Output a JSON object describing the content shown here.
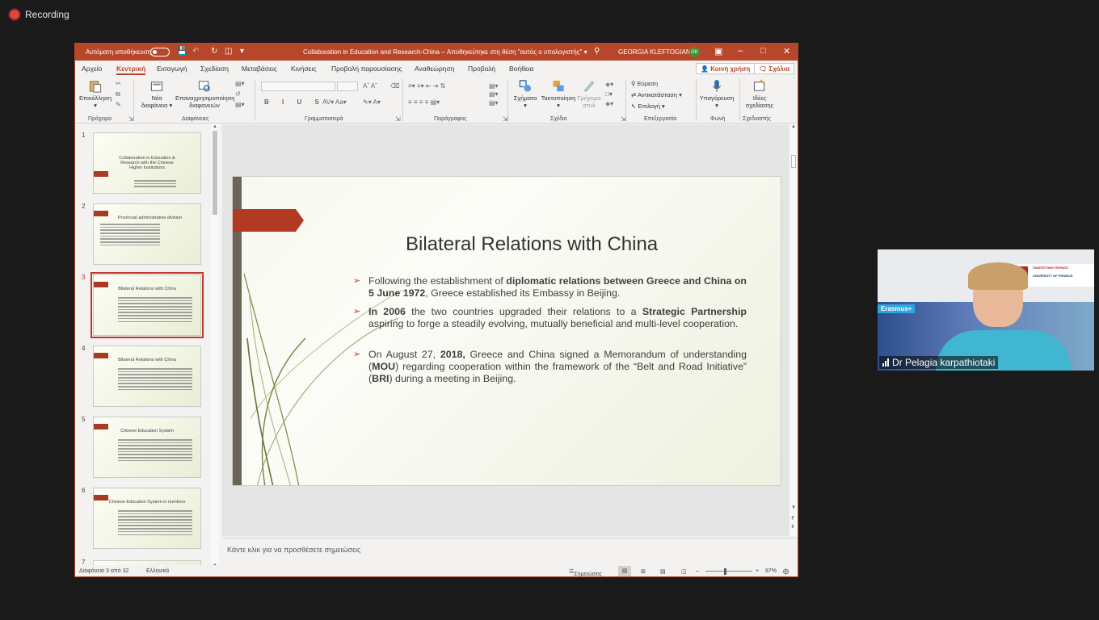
{
  "recording": {
    "label": "Recording"
  },
  "titlebar": {
    "autosave": "Αυτόματη αποθήκευση",
    "document": "Collaboration in Education and Research-China",
    "saved": "Αποθηκεύτηκε στη θέση \"αυτός ο υπολογιστής\"",
    "user": "GEORGIA KLEFTOGIANNI",
    "avatar": "GK"
  },
  "tabs": [
    "Αρχείο",
    "Κεντρική",
    "Εισαγωγή",
    "Σχεδίαση",
    "Μεταβάσεις",
    "Κινήσεις",
    "Προβολή παρουσίασης",
    "Αναθεώρηση",
    "Προβολή",
    "Βοήθεια"
  ],
  "active_tab": "Κεντρική",
  "share": "Κοινή χρήση",
  "comments": "Σχόλια",
  "ribbon": {
    "paste": "Επικόλληση",
    "new_slide": "Νέα διαφάνεια",
    "reuse": "Επαναχρησιμοποίηση διαφανειών",
    "shapes": "Σχήματα",
    "arrange": "Τακτοποίηση",
    "quick_styles": "Γρήγορα στυλ",
    "find": "Εύρεση",
    "replace": "Αντικατάσταση",
    "select": "Επιλογή",
    "dictate": "Υπαγόρευση",
    "ideas": "Ιδέες σχεδίασης",
    "groups": [
      "Πρόχειρο",
      "Διαφάνειες",
      "Γραμματοσειρά",
      "Παράγραφος",
      "Σχέδιο",
      "Επεξεργασία",
      "Φωνή",
      "Σχεδιαστής"
    ]
  },
  "thumbnails": [
    {
      "num": "1",
      "title": "Collaboration in Education & Research with the Chinese Higher Institutions"
    },
    {
      "num": "2",
      "title": "Provincial administrative division"
    },
    {
      "num": "3",
      "title": "Bilateral Relations with China"
    },
    {
      "num": "4",
      "title": "Bilateral Relations with China"
    },
    {
      "num": "5",
      "title": "Chinese Education System"
    },
    {
      "num": "6",
      "title": "Chinese Education System in numbers"
    },
    {
      "num": "7",
      "title": ""
    }
  ],
  "slide": {
    "title": "Bilateral Relations with China",
    "bullets": [
      [
        "Following the establishment of ",
        "diplomatic relations between Greece and China on 5 June 1972",
        ", Greece established its Embassy in Beijing."
      ],
      [
        "",
        "In 2006",
        " the two countries upgraded their relations to a ",
        "Strategic Partnership",
        " aspiring to forge a steadily evolving, mutually beneficial and multi-level cooperation."
      ],
      [
        "On August 27, ",
        "2018,",
        " Greece and China signed a Memorandum of understanding (",
        "MOU",
        ") regarding cooperation within the framework of the “Belt and Road Initiative” (",
        "BRI",
        ")  during a meeting in Beijing."
      ]
    ]
  },
  "notes_placeholder": "Κάντε κλικ για να προσθέσετε σημειώσεις",
  "status": {
    "slide_of": "Διαφάνεια 3 από 32",
    "language": "Ελληνικά",
    "notes": "Σημειώσεις",
    "zoom": "87%"
  },
  "camera": {
    "name": "Dr Pelagia karpathiotaki",
    "banner": "Erasmus+",
    "logo_line1": "ΠΑΝΕΠΙΣΤΗΜΙΟ ΠΕΙΡΑΙΩΣ",
    "logo_line2": "UNIVERSITY OF PIRAEUS"
  }
}
